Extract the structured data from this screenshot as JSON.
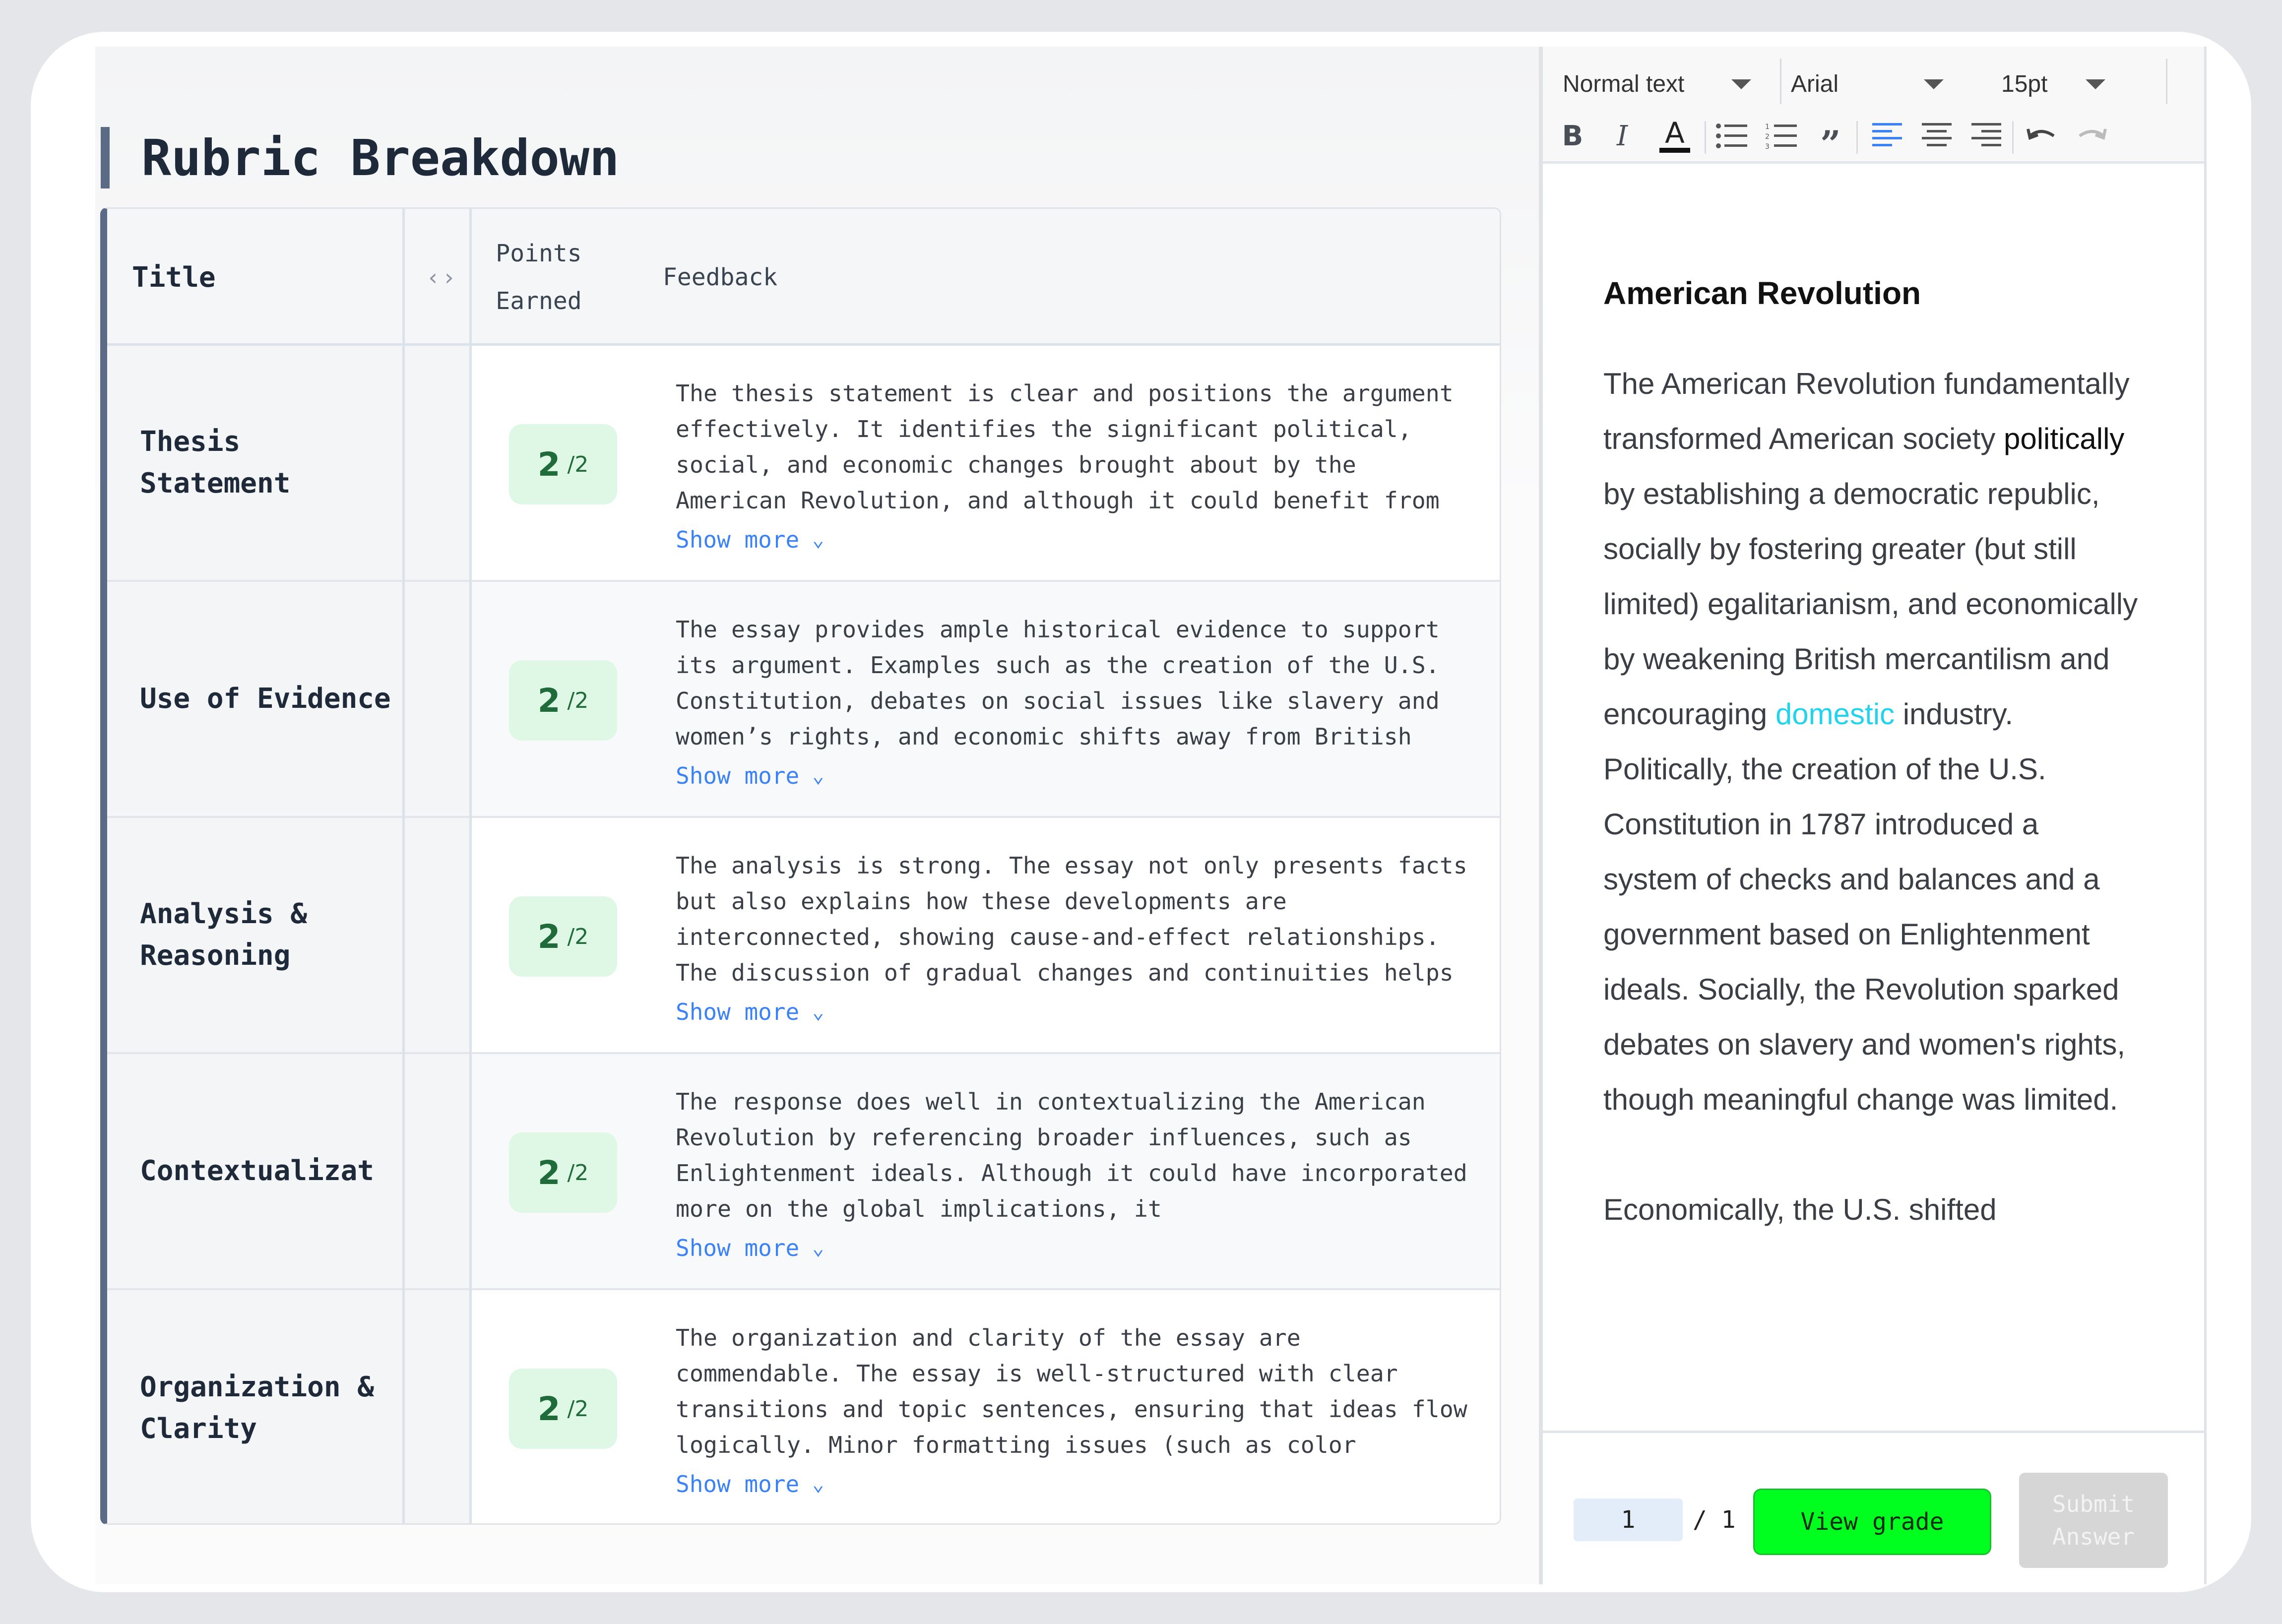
{
  "rubric": {
    "heading": "Rubric Breakdown",
    "columns": {
      "title": "Title",
      "toggle": "<>",
      "points": "Points Earned",
      "feedback": "Feedback"
    },
    "rows": [
      {
        "title": "Thesis Statement",
        "points": "2",
        "max": "/2",
        "feedback": "The thesis statement is clear and positions the argument effectively. It identifies the significant political, social, and economic changes brought about by the American Revolution, and although it could benefit from",
        "show_more": "Show more"
      },
      {
        "title": "Use of Evidence",
        "points": "2",
        "max": "/2",
        "feedback": "The essay provides ample historical evidence to support its argument. Examples such as the creation of the U.S. Constitution, debates on social issues like slavery and women’s rights, and economic shifts away from British",
        "show_more": "Show more"
      },
      {
        "title": "Analysis & Reasoning",
        "points": "2",
        "max": "/2",
        "feedback": "The analysis is strong. The essay not only presents facts but also explains how these developments are interconnected, showing cause-and-effect relationships. The discussion of gradual changes and continuities helps",
        "show_more": "Show more"
      },
      {
        "title": "Contextualizat",
        "points": "2",
        "max": "/2",
        "feedback": "The response does well in contextualizing the American Revolution by referencing broader influences, such as Enlightenment ideals. Although it could have incorporated more on the global implications, it",
        "show_more": "Show more"
      },
      {
        "title": "Organization & Clarity",
        "points": "2",
        "max": "/2",
        "feedback": "The organization and clarity of the essay are commendable. The essay is well-structured with clear transitions and topic sentences, ensuring that ideas flow logically. Minor formatting issues (such as color",
        "show_more": "Show more"
      }
    ]
  },
  "editor": {
    "toolbar": {
      "style": "Normal text",
      "font": "Arial",
      "size": "15pt",
      "buttons": [
        "bold",
        "italic",
        "text-color",
        "bulleted-list",
        "numbered-list",
        "quote",
        "align-left",
        "align-center",
        "align-right",
        "undo",
        "redo"
      ]
    },
    "doc_title": "American Revolution",
    "para1_a": "The American Revolution fundamentally transformed American society ",
    "para1_b": "politically",
    "para1_c": " by establishing a democratic republic, socially by fostering greater (but still limited) egalitarianism, and economically by weakening British mercantilism and encouraging ",
    "para1_d": "domestic",
    "para1_e": " industry. Politically, the creation of the U.S. Constitution in 1787 introduced a system of checks and balances and a government based on Enlightenment ideals. Socially, the Revolution sparked debates on slavery and women's rights, though meaningful change was limited.",
    "para2": "Economically, the U.S. shifted",
    "footer": {
      "page_value": "1",
      "page_total": "/ 1",
      "view_grade": "View grade",
      "submit": "Submit Answer"
    },
    "colors": {
      "view_grade_bg": "#00ff1e",
      "highlight_cyan": "#22d3ee"
    }
  }
}
